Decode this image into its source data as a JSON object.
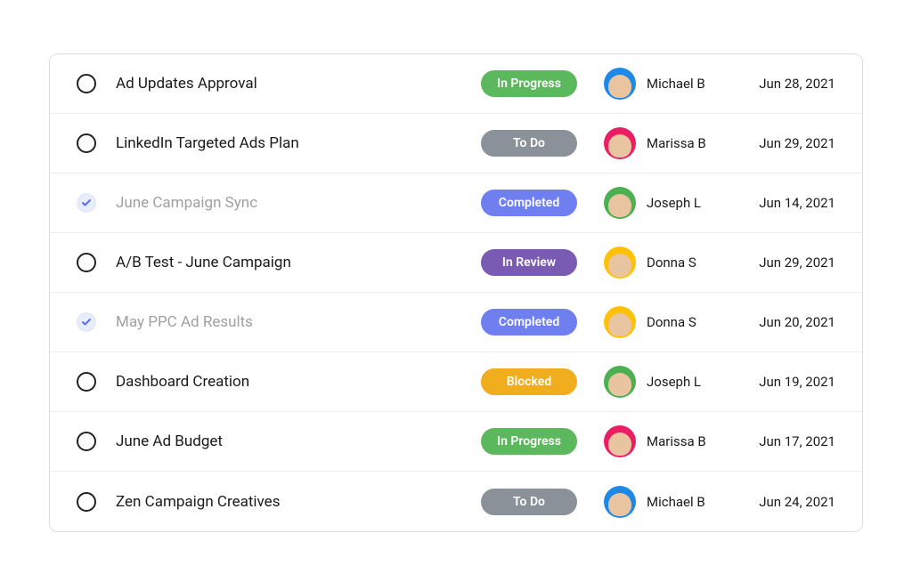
{
  "tasks": [
    {
      "title": "Ad Updates Approval",
      "status": "In Progress",
      "status_type": "in-progress",
      "assignee": "Michael B",
      "avatar": "michael",
      "date": "Jun 28, 2021",
      "completed": false
    },
    {
      "title": "LinkedIn Targeted Ads Plan",
      "status": "To Do",
      "status_type": "to-do",
      "assignee": "Marissa B",
      "avatar": "marissa",
      "date": "Jun 29, 2021",
      "completed": false
    },
    {
      "title": "June Campaign Sync",
      "status": "Completed",
      "status_type": "completed",
      "assignee": "Joseph L",
      "avatar": "joseph",
      "date": "Jun 14, 2021",
      "completed": true
    },
    {
      "title": "A/B Test - June Campaign",
      "status": "In Review",
      "status_type": "in-review",
      "assignee": "Donna S",
      "avatar": "donna",
      "date": "Jun 29, 2021",
      "completed": false
    },
    {
      "title": "May PPC Ad Results",
      "status": "Completed",
      "status_type": "completed",
      "assignee": "Donna S",
      "avatar": "donna",
      "date": "Jun 20, 2021",
      "completed": true
    },
    {
      "title": "Dashboard Creation",
      "status": "Blocked",
      "status_type": "blocked",
      "assignee": "Joseph L",
      "avatar": "joseph",
      "date": "Jun 19, 2021",
      "completed": false
    },
    {
      "title": "June Ad Budget",
      "status": "In Progress",
      "status_type": "in-progress",
      "assignee": "Marissa B",
      "avatar": "marissa",
      "date": "Jun 17, 2021",
      "completed": false
    },
    {
      "title": "Zen Campaign Creatives",
      "status": "To Do",
      "status_type": "to-do",
      "assignee": "Michael B",
      "avatar": "michael",
      "date": "Jun 24, 2021",
      "completed": false
    }
  ]
}
